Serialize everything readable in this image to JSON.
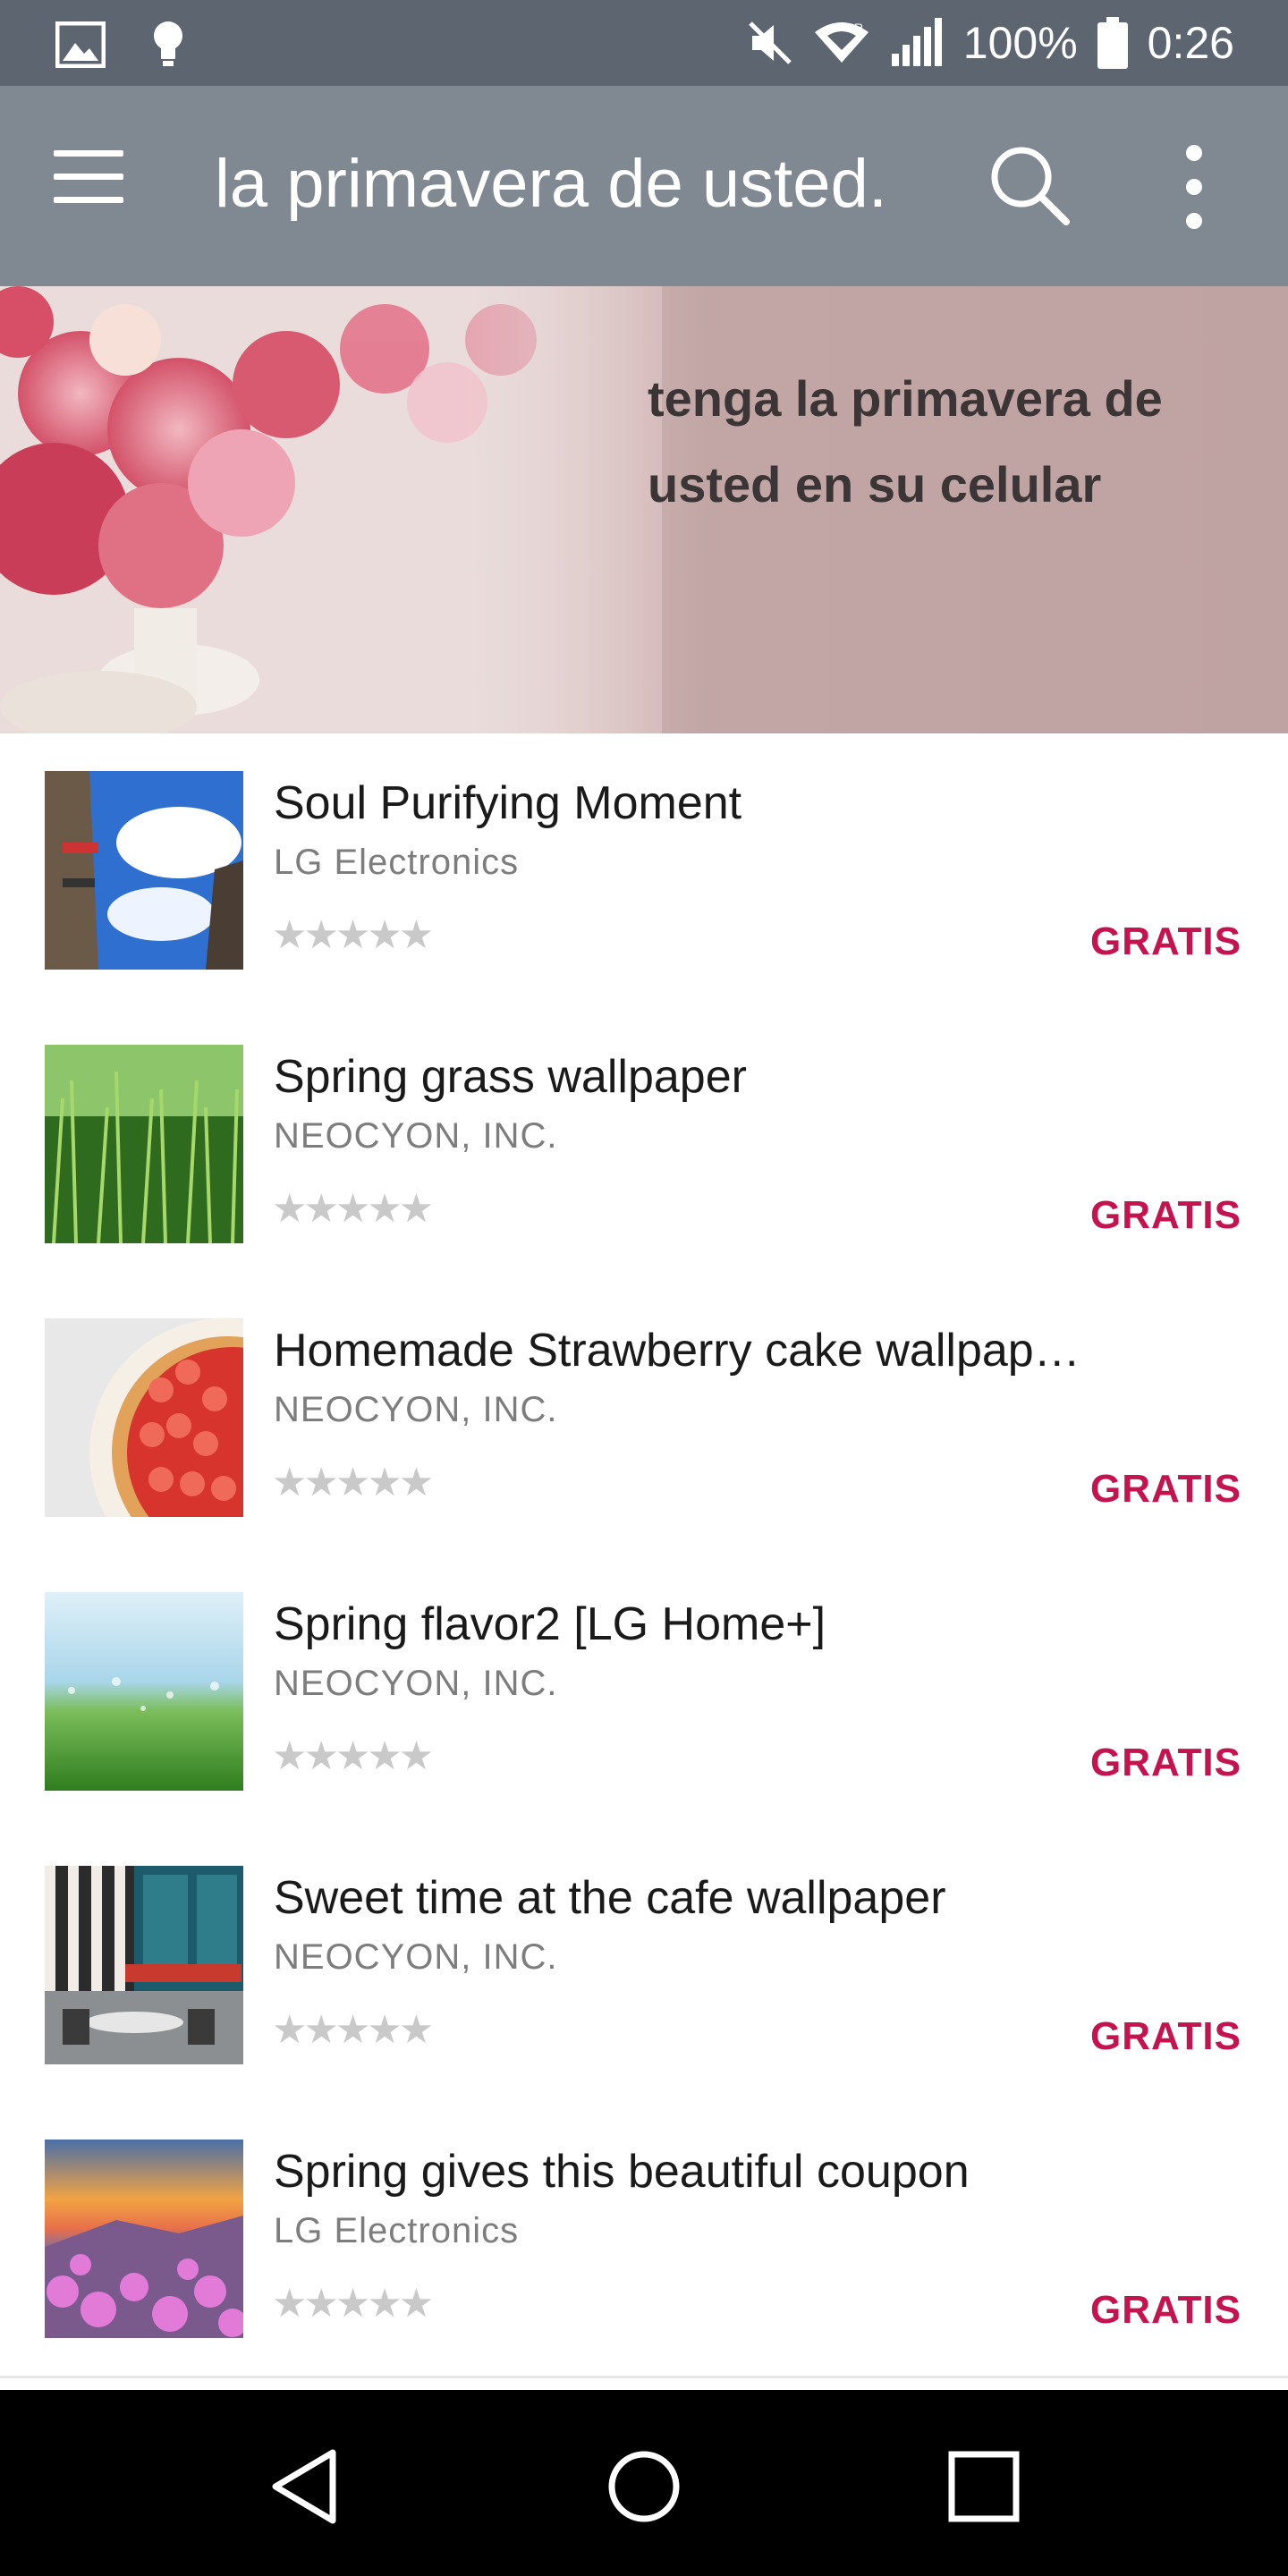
{
  "status_bar": {
    "battery": "100%",
    "time": "0:26",
    "icons": [
      "image-icon",
      "bulb-icon",
      "mute-icon",
      "wifi-icon",
      "signal-icon",
      "battery-icon"
    ]
  },
  "app_bar": {
    "title": "la primavera de usted.",
    "icons": [
      "menu-icon",
      "search-icon",
      "more-vert-icon"
    ]
  },
  "banner": {
    "text": "tenga la primavera de usted en su celular"
  },
  "items": [
    {
      "title": "Soul Purifying Moment",
      "publisher": "LG Electronics",
      "rating": "★★★★★",
      "price": "GRATIS"
    },
    {
      "title": "Spring grass wallpaper",
      "publisher": "NEOCYON, INC.",
      "rating": "★★★★★",
      "price": "GRATIS"
    },
    {
      "title": "Homemade Strawberry cake wallpap…",
      "publisher": "NEOCYON, INC.",
      "rating": "★★★★★",
      "price": "GRATIS"
    },
    {
      "title": "Spring flavor2 [LG Home+]",
      "publisher": "NEOCYON, INC.",
      "rating": "★★★★★",
      "price": "GRATIS"
    },
    {
      "title": "Sweet time at the cafe wallpaper",
      "publisher": "NEOCYON, INC.",
      "rating": "★★★★★",
      "price": "GRATIS"
    },
    {
      "title": "Spring gives this beautiful coupon",
      "publisher": "LG Electronics",
      "rating": "★★★★★",
      "price": "GRATIS"
    }
  ],
  "nav_bar": {
    "icons": [
      "back-icon",
      "home-icon",
      "recents-icon"
    ]
  },
  "colors": {
    "status_bar": "#5d6670",
    "app_bar": "#808991",
    "price": "#c4134f",
    "banner": "#c2a6a6"
  }
}
